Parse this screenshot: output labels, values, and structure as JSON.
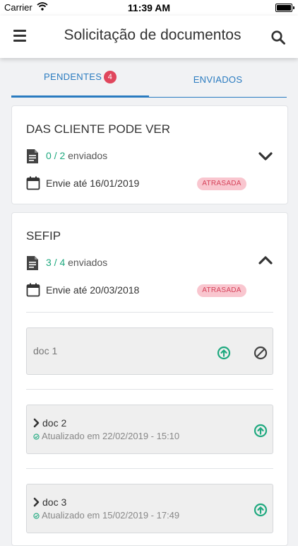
{
  "status_bar": {
    "carrier": "Carrier",
    "time": "11:39 AM"
  },
  "header": {
    "title": "Solicitação de documentos"
  },
  "tabs": [
    {
      "label": "PENDENTES",
      "badge": "4",
      "active": true
    },
    {
      "label": "ENVIADOS",
      "active": false
    }
  ],
  "requests": [
    {
      "title": "DAS CLIENTE PODE VER",
      "count": "0 / 2",
      "count_suffix": "enviados",
      "due": "Envie até 16/01/2019",
      "tag": "ATRASADA",
      "expanded": false
    },
    {
      "title": "SEFIP",
      "count": "3 / 4",
      "count_suffix": "enviados",
      "due": "Envie até 20/03/2018",
      "tag": "ATRASADA",
      "expanded": true,
      "docs": [
        {
          "name": "doc 1",
          "updated": ""
        },
        {
          "name": "doc 2",
          "updated": "Atualizado em 22/02/2019 - 15:10"
        },
        {
          "name": "doc 3",
          "updated": "Atualizado em 15/02/2019 - 17:49"
        }
      ]
    }
  ],
  "colors": {
    "accent": "#2a7bc0",
    "success": "#1fa97f",
    "danger": "#e0465c",
    "tag_bg": "#f9c6cf"
  }
}
